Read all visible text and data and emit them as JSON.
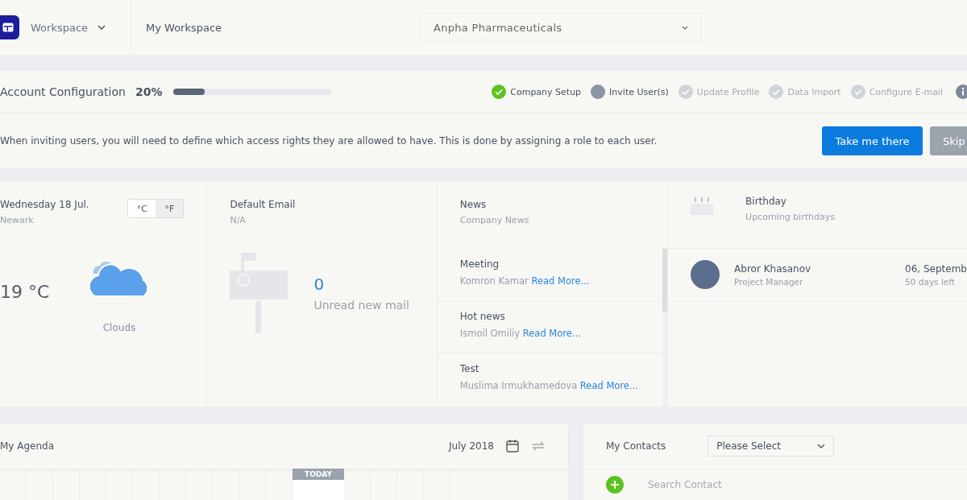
{
  "header": {
    "workspace_menu": "Workspace",
    "workspace_name": "My Workspace",
    "company_select": "Anpha Pharmaceuticals"
  },
  "account_configuration": {
    "title": "Account Configuration",
    "percent": "20%",
    "level": 0.2,
    "steps": [
      {
        "label": "Company Setup",
        "completed": true,
        "active": false
      },
      {
        "label": "Invite User(s)",
        "completed": false,
        "active": true
      },
      {
        "label": "Update Profile",
        "completed": false,
        "active": false
      },
      {
        "label": "Data Import",
        "completed": false,
        "active": false
      },
      {
        "label": "Configure E-mail",
        "completed": false,
        "active": false
      }
    ]
  },
  "hint": {
    "message": "When inviting users, you will need to define which access rights they are allowed to have. This is done by assigning a role to each user.",
    "primary_button": "Take me there",
    "secondary_button": "Skip"
  },
  "weather": {
    "date": "Wednesday 18 Jul.",
    "city": "Newark",
    "units": [
      {
        "label": "°C",
        "selected": false
      },
      {
        "label": "°F",
        "selected": true
      }
    ],
    "temperature": "19 °C",
    "condition": "Clouds"
  },
  "email": {
    "title": "Default Email",
    "address": "N/A",
    "count": "0",
    "caption": "Unread new mail"
  },
  "news": {
    "title": "News",
    "subtitle": "Company News",
    "items": [
      {
        "title": "Meeting",
        "author": "Komron Kamar",
        "link": "Read More..."
      },
      {
        "title": "Hot news",
        "author": "Ismoil Omiliy",
        "link": "Read More..."
      },
      {
        "title": "Test",
        "author": "Muslima Irmukhamedova",
        "link": "Read More..."
      }
    ]
  },
  "birthday": {
    "title": "Birthday",
    "subtitle": "Upcoming birthdays",
    "people": [
      {
        "name": "Abror Khasanov",
        "role": "Project Manager",
        "date": "06, Septemb",
        "remaining": "50 days left"
      }
    ]
  },
  "agenda": {
    "title": "My Agenda",
    "month": "July 2018",
    "today_label": "TODAY"
  },
  "contacts": {
    "title": "My Contacts",
    "filter": "Please Select",
    "search_placeholder": "Search Contact"
  }
}
